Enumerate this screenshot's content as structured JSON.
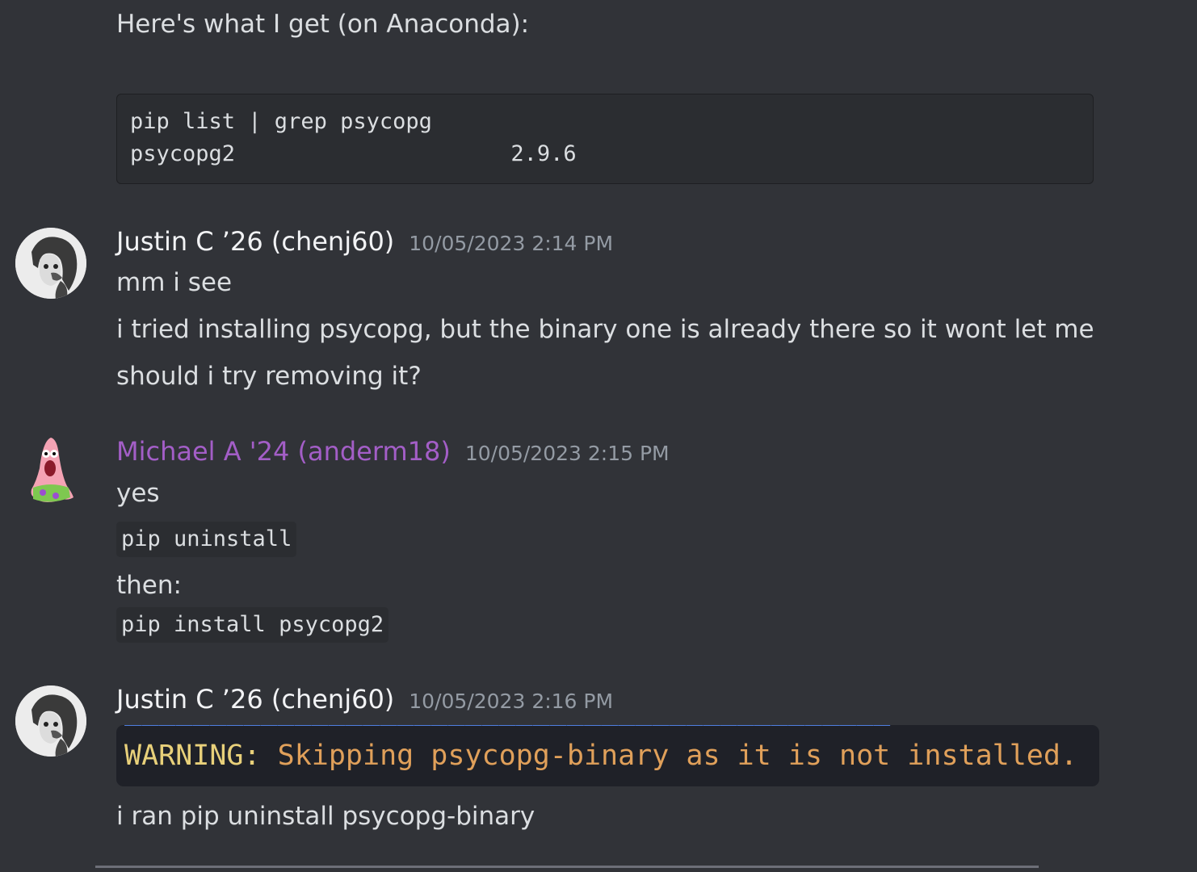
{
  "messages": {
    "prev": {
      "text": "Here's what I get (on Anaconda):",
      "code_line1": "pip list | grep psycopg",
      "code_line2": "psycopg2                     2.9.6"
    },
    "m1": {
      "author": "Justin C ’26 (chenj60)",
      "timestamp": "10/05/2023 2:14 PM",
      "line1": "mm i see",
      "line2": "i tried installing psycopg, but the binary one is already there so it wont let me",
      "line3": "should i try removing it?"
    },
    "m2": {
      "author": "Michael A '24 (anderm18)",
      "timestamp": "10/05/2023 2:15 PM",
      "line1": "yes",
      "code1": "pip uninstall",
      "line2": "then:",
      "code2": "pip install psycopg2"
    },
    "m3": {
      "author": "Justin C ’26 (chenj60)",
      "timestamp": "10/05/2023 2:16 PM",
      "attachment_warning_keyword": "WARNING:",
      "attachment_warning_text": " Skipping psycopg-binary as it is not installed.",
      "line1": "i ran pip uninstall psycopg-binary"
    }
  },
  "colors": {
    "background": "#313338",
    "author_purple": "#a35ec7"
  }
}
